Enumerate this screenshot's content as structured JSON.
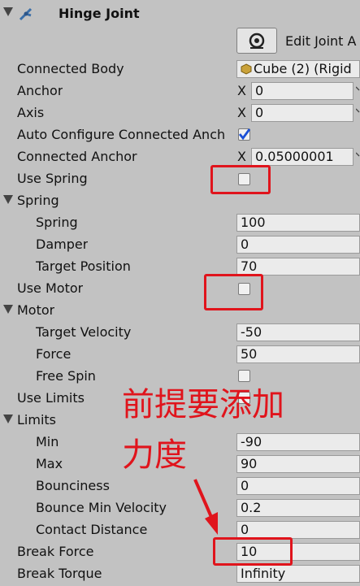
{
  "component": {
    "title": "Hinge Joint",
    "edit_label": "Edit Joint A"
  },
  "rows": {
    "connected_body": {
      "label": "Connected Body",
      "value": "Cube (2) (Rigid"
    },
    "anchor": {
      "label": "Anchor",
      "axis": "X",
      "value": "0"
    },
    "axis": {
      "label": "Axis",
      "axis": "X",
      "value": "0"
    },
    "auto_configure": {
      "label": "Auto Configure Connected Anch",
      "checked": true
    },
    "connected_anchor": {
      "label": "Connected Anchor",
      "axis": "X",
      "value": "0.05000001"
    },
    "use_spring": {
      "label": "Use Spring",
      "checked": false
    },
    "spring_section": {
      "label": "Spring"
    },
    "spring": {
      "label": "Spring",
      "value": "100"
    },
    "damper": {
      "label": "Damper",
      "value": "0"
    },
    "target_position": {
      "label": "Target Position",
      "value": "70"
    },
    "use_motor": {
      "label": "Use Motor",
      "checked": false
    },
    "motor_section": {
      "label": "Motor"
    },
    "target_velocity": {
      "label": "Target Velocity",
      "value": "-50"
    },
    "force": {
      "label": "Force",
      "value": "50"
    },
    "free_spin": {
      "label": "Free Spin",
      "checked": false
    },
    "use_limits": {
      "label": "Use Limits",
      "checked": false
    },
    "limits_section": {
      "label": "Limits"
    },
    "min": {
      "label": "Min",
      "value": "-90"
    },
    "max": {
      "label": "Max",
      "value": "90"
    },
    "bounciness": {
      "label": "Bounciness",
      "value": "0"
    },
    "bounce_min_velocity": {
      "label": "Bounce Min Velocity",
      "value": "0.2"
    },
    "contact_distance": {
      "label": "Contact Distance",
      "value": "0"
    },
    "break_force": {
      "label": "Break Force",
      "value": "10"
    },
    "break_torque": {
      "label": "Break Torque",
      "value": "Infinity"
    }
  },
  "annotation": {
    "line1": "前提要添加",
    "line2": "力度"
  },
  "colors": {
    "panel_bg": "#c2c2c2",
    "field_bg": "#ebebeb",
    "annotation_red": "#e0141c",
    "check_blue": "#1a4fd6"
  }
}
